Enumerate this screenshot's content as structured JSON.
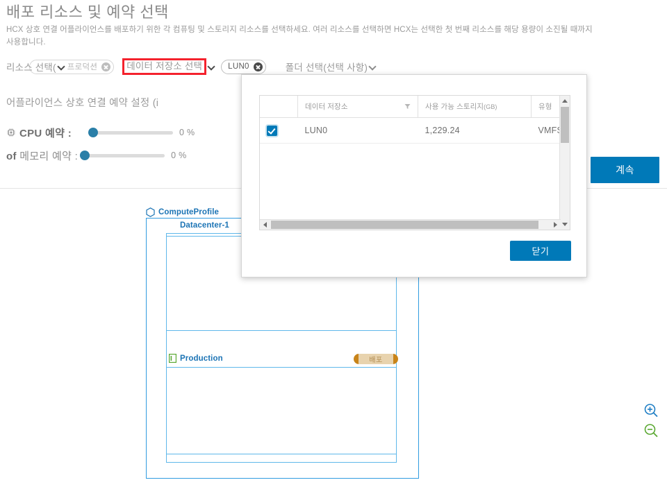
{
  "header": {
    "title": "배포 리소스 및 예약 선택",
    "subtitle": "HCX 상호 연결 어플라이언스를 배포하기 위한 각 컴퓨팅 및 스토리지 리소스를 선택하세요. 여러 리소스를 선택하면 HCX는 선택한 첫 번째 리소스를 해당 용량이 소진될 때까지 사용합니다."
  },
  "selectors": {
    "resource_label": "리소스 선택(",
    "resource_chip": "프로덕션",
    "datastore_label": "데이터 저장소 선택",
    "datastore_chip": "LUN0",
    "folder_label": "폴더 선택(선택 사항)",
    "highlight_color": "#f4222d"
  },
  "reservation": {
    "title": "어플라이언스 상호 연결 예약 설정 (i",
    "cpu": {
      "icon": "cpu-chip-icon",
      "label": "CPU 예약 :",
      "value": "0 %",
      "percent": 0
    },
    "memory": {
      "icon": "memory-icon",
      "label_prefix": "of",
      "label": "메모리 예약 :",
      "value": "0 %",
      "percent": 0
    },
    "slider_color": "#2a7fa8"
  },
  "actions": {
    "continue_label": "계속",
    "continue_color": "#0079b8"
  },
  "dialog": {
    "columns": [
      "",
      "데이터 저장소",
      "사용 가능 스토리지(GB)",
      "유형"
    ],
    "column_storage_main": "사용 가능 스토리지",
    "column_storage_unit": "(GB)",
    "rows": [
      {
        "checked": true,
        "datastore": "LUN0",
        "available_storage": "1,229.24",
        "type": "VMFS"
      }
    ],
    "close_label": "닫기",
    "close_color": "#0079b8",
    "filter_icon": "filter-icon"
  },
  "diagram": {
    "compute_profile_label": "ComputeProfile",
    "datacenter_label": "Datacenter-1",
    "production_label": "Production",
    "deploy_badge": "배포",
    "border_color": "#2f9be0",
    "label_color": "#1c74b5"
  },
  "zoom_controls": {
    "zoom_in_icon": "zoom-in-icon",
    "zoom_out_icon": "zoom-out-icon",
    "zoom_in_color": "#1f7ec4",
    "zoom_out_color": "#5aa832"
  }
}
